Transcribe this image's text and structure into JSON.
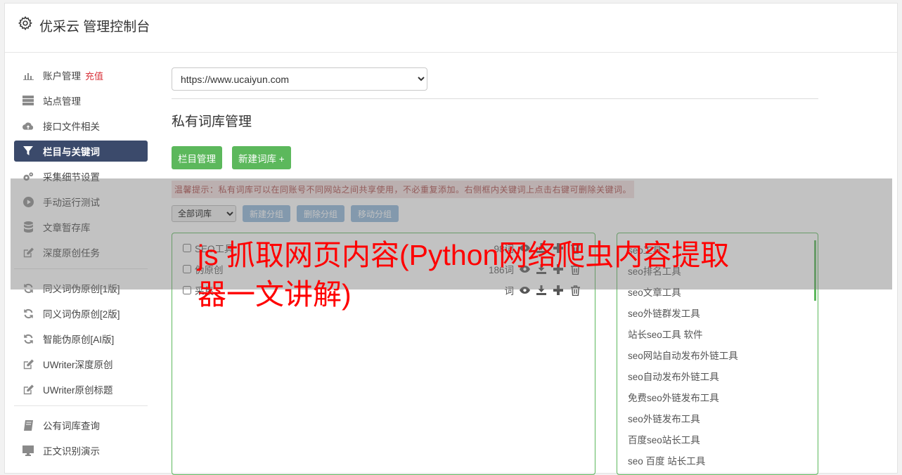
{
  "header": {
    "title": "优采云 管理控制台",
    "icon": "gear-icon"
  },
  "sidebar": {
    "group1": [
      {
        "label": "账户管理",
        "badge": "充值",
        "icon": "bar-chart-icon"
      },
      {
        "label": "站点管理",
        "icon": "server-icon"
      },
      {
        "label": "接口文件相关",
        "icon": "cloud-upload-icon"
      },
      {
        "label": "栏目与关键词",
        "icon": "filter-icon",
        "active": true
      },
      {
        "label": "采集细节设置",
        "icon": "cogs-icon"
      },
      {
        "label": "手动运行测试",
        "icon": "play-icon"
      },
      {
        "label": "文章暂存库",
        "icon": "database-icon"
      },
      {
        "label": "深度原创任务",
        "icon": "edit-icon"
      }
    ],
    "group2": [
      {
        "label": "同义词伪原创[1版]",
        "icon": "refresh-icon"
      },
      {
        "label": "同义词伪原创[2版]",
        "icon": "refresh-icon"
      },
      {
        "label": "智能伪原创[AI版]",
        "icon": "refresh-icon"
      },
      {
        "label": "UWriter深度原创",
        "icon": "edit-icon"
      },
      {
        "label": "UWriter原创标题",
        "icon": "edit-icon"
      }
    ],
    "group3": [
      {
        "label": "公有词库查询",
        "icon": "book-icon"
      },
      {
        "label": "正文识别演示",
        "icon": "monitor-icon"
      }
    ]
  },
  "site_select": {
    "value": "https://www.ucaiyun.com"
  },
  "section_title": "私有词库管理",
  "buttons": {
    "columns": "栏目管理",
    "new_lib": "新建词库 +"
  },
  "tip": "温馨提示：私有词库可以在同账号不同网站之间共享使用，不必重复添加。右侧框内关键词上点击右键可删除关键词。",
  "controls": {
    "lib_filter": "全部词库",
    "new_group": "新建分组",
    "delete_group": "删除分组",
    "move_group": "移动分组"
  },
  "libraries": [
    {
      "name": "SEO工具",
      "count": "98词"
    },
    {
      "name": "伪原创",
      "count": "186词"
    },
    {
      "name": "采集",
      "count": "词"
    }
  ],
  "keywords": [
    "seo工具",
    "seo排名工具",
    "seo文章工具",
    "seo外链群发工具",
    "站长seo工具 软件",
    "seo网站自动发布外链工具",
    "seo自动发布外链工具",
    "免费seo外链发布工具",
    "seo外链发布工具",
    "百度seo站长工具",
    "seo 百度 站长工具"
  ],
  "overlay": {
    "title": "js 抓取网页内容(Python网络爬虫内容提取器一文讲解)"
  },
  "colors": {
    "accent_green": "#5cb85c",
    "active_nav": "#3b4a6b",
    "overlay_text": "#ff0000",
    "tip_text": "#a94442"
  }
}
